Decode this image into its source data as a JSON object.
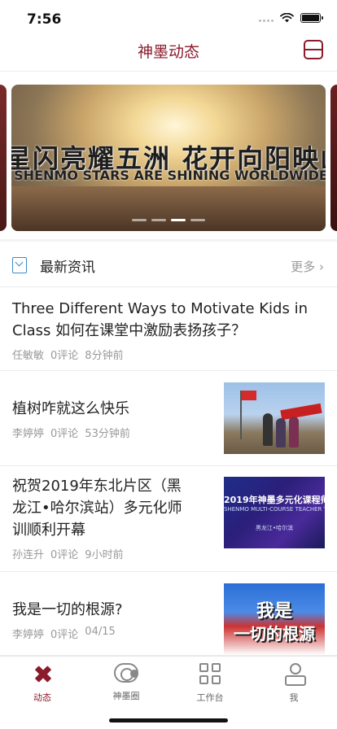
{
  "status_bar": {
    "time": "7:56"
  },
  "nav": {
    "title": "神墨动态",
    "menu_icon": "menu-icon"
  },
  "banner": {
    "title_cn": "星闪亮耀五洲  花开向阳映山",
    "title_en": "SHENMO STARS ARE SHINING WORLDWIDE",
    "slide_count": 4,
    "active_slide": 3
  },
  "section": {
    "title": "最新资讯",
    "more_label": "更多 ›",
    "icon": "bookmark-icon"
  },
  "news": [
    {
      "title_line1": "Three Different Ways to Motivate Kids in",
      "title_line2": "Class 如何在课堂中激励表扬孩子？",
      "author": "任敏敏",
      "comments": "0评论",
      "time": "8分钟前"
    },
    {
      "title": "植树咋就这么快乐",
      "author": "李婷婷",
      "comments": "0评论",
      "time": "53分钟前"
    },
    {
      "title_line1": "祝贺2019年东北片区（黑",
      "title_line2": "龙江•哈尔滨站）多元化师",
      "title_line3": "训顺利开幕",
      "author": "孙连升",
      "comments": "0评论",
      "time": "9小时前",
      "thumb_text": "2019年神墨多元化课程师",
      "thumb_sub": "SHENMO MULTI-COURSE TEACHER TRAIN",
      "thumb_loc": "黑龙江•哈尔滨"
    },
    {
      "title": "我是一切的根源?",
      "author": "李婷婷",
      "comments": "0评论",
      "time": "04/15",
      "thumb_line1": "我是",
      "thumb_line2": "一切的根源"
    }
  ],
  "tabs": [
    {
      "label": "动态",
      "icon": "dynamics-icon",
      "active": true
    },
    {
      "label": "神墨圈",
      "icon": "circle-icon",
      "active": false
    },
    {
      "label": "工作台",
      "icon": "workbench-icon",
      "active": false
    },
    {
      "label": "我",
      "icon": "user-icon",
      "active": false
    }
  ],
  "colors": {
    "brand": "#8b1a2b",
    "accent_icon": "#3d8ac9",
    "meta_text": "#999999"
  }
}
